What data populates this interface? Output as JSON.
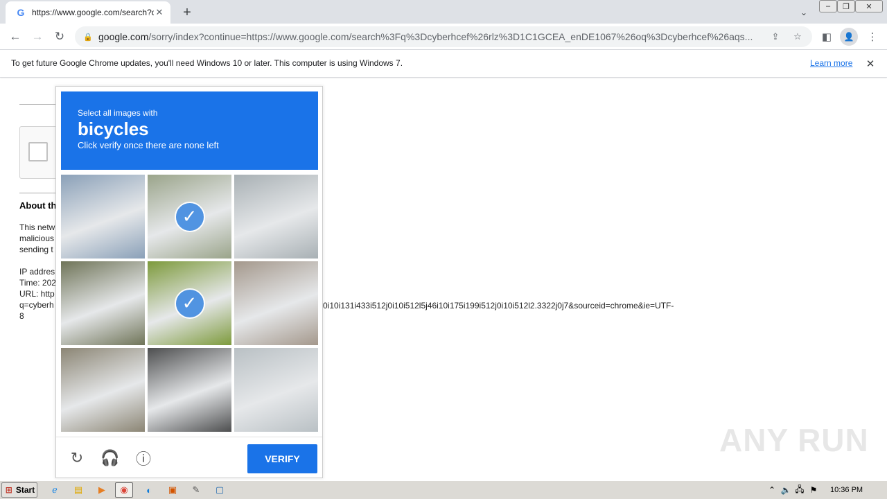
{
  "browser": {
    "tab_title": "https://www.google.com/search?q=",
    "url_host": "google.com",
    "url_rest": "/sorry/index?continue=https://www.google.com/search%3Fq%3Dcyberhcef%26rlz%3D1C1GCEA_enDE1067%26oq%3Dcyberhcef%26aqs..."
  },
  "infobar": {
    "message": "To get future Google Chrome updates, you'll need Windows 10 or later. This computer is using Windows 7.",
    "link": "Learn more"
  },
  "page": {
    "about_heading": "About th",
    "para_lines": [
      "This netw",
      "malicious",
      "sending t"
    ],
    "ip_line": "IP addres",
    "time_line": "Time: 202",
    "url_line": "URL: http",
    "q_line": "q=cyberh",
    "url_tail": "0i10i131i433i512j0i10i512l5j46i10i175i199i512j0i10i512l2.3322j0j7&sourceid=chrome&ie=UTF-",
    "url_wrap": "8"
  },
  "captcha": {
    "prompt_small": "Select all images with",
    "target_word": "bicycles",
    "prompt_sub": "Click verify once there are none left",
    "tiles": [
      {
        "name": "highway-sign",
        "selected": false,
        "color": "#8aa0b8"
      },
      {
        "name": "person-with-bicycle",
        "selected": true,
        "color": "#9aa48a"
      },
      {
        "name": "street-with-van",
        "selected": false,
        "color": "#a8b0b4"
      },
      {
        "name": "tractor",
        "selected": false,
        "color": "#6f7458"
      },
      {
        "name": "field-cyclist",
        "selected": true,
        "color": "#7d9a3c"
      },
      {
        "name": "street-parked-bicycle",
        "selected": false,
        "color": "#a4988c"
      },
      {
        "name": "bus",
        "selected": false,
        "color": "#8b8574"
      },
      {
        "name": "parked-car",
        "selected": false,
        "color": "#4d4e4f"
      },
      {
        "name": "shop-sign",
        "selected": false,
        "color": "#b9c0c4"
      }
    ],
    "verify_label": "VERIFY"
  },
  "watermark": "ANY RUN",
  "taskbar": {
    "start_label": "Start",
    "clock": "10:36 PM"
  },
  "colors": {
    "captcha_blue": "#1a73e8",
    "check_blue": "#4a90e2"
  }
}
